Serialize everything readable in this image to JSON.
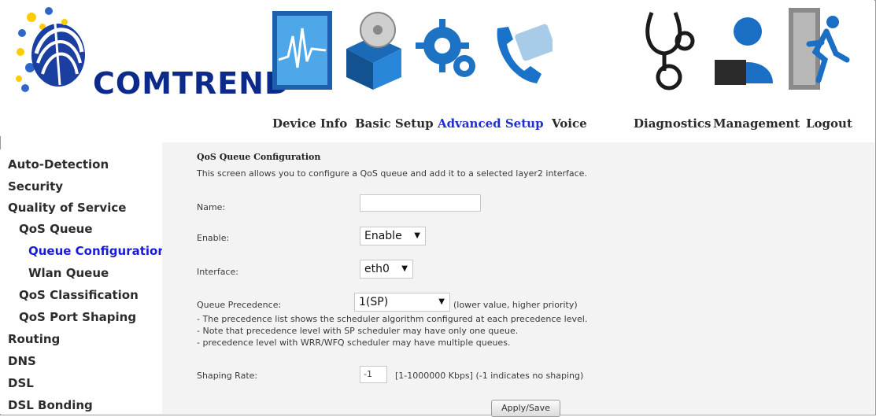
{
  "brand": {
    "name": "COMTREND"
  },
  "nav": {
    "items": [
      {
        "label": "Device Info",
        "icon": "monitor-graph-icon"
      },
      {
        "label": "Basic Setup",
        "icon": "box-disc-icon"
      },
      {
        "label": "Advanced Setup",
        "icon": "gear-icon",
        "active": true
      },
      {
        "label": "Voice",
        "icon": "phone-icon"
      },
      {
        "label": "Diagnostics",
        "icon": "stethoscope-icon"
      },
      {
        "label": "Management",
        "icon": "user-icon"
      },
      {
        "label": "Logout",
        "icon": "exit-icon"
      }
    ],
    "active_color": "#1f2fd0"
  },
  "sidebar": {
    "items": [
      {
        "label": "Auto-Detection"
      },
      {
        "label": "Security"
      },
      {
        "label": "Quality of Service"
      },
      {
        "label": "QoS Queue"
      },
      {
        "label": "Queue Configuration",
        "active": true
      },
      {
        "label": "Wlan Queue"
      },
      {
        "label": "QoS Classification"
      },
      {
        "label": "QoS Port Shaping"
      },
      {
        "label": "Routing"
      },
      {
        "label": "DNS"
      },
      {
        "label": "DSL"
      },
      {
        "label": "DSL Bonding"
      }
    ]
  },
  "form": {
    "title": "QoS Queue Configuration",
    "description": "This screen allows you to configure a QoS queue and add it to a selected layer2 interface.",
    "name_label": "Name:",
    "name_value": "",
    "enable_label": "Enable:",
    "enable_value": "Enable",
    "interface_label": "Interface:",
    "interface_value": "eth0",
    "precedence_label": "Queue Precedence:",
    "precedence_value": "1(SP)",
    "precedence_hint": "(lower value, higher priority)",
    "notes": [
      "- The precedence list shows the scheduler algorithm configured at each precedence level.",
      "- Note that precedence level with SP scheduler may have only one queue.",
      "- precedence level with WRR/WFQ scheduler may have multiple queues."
    ],
    "shaping_label": "Shaping Rate:",
    "shaping_value": "-1",
    "shaping_hint": "[1-1000000 Kbps] (-1 indicates no shaping)",
    "apply_label": "Apply/Save"
  }
}
